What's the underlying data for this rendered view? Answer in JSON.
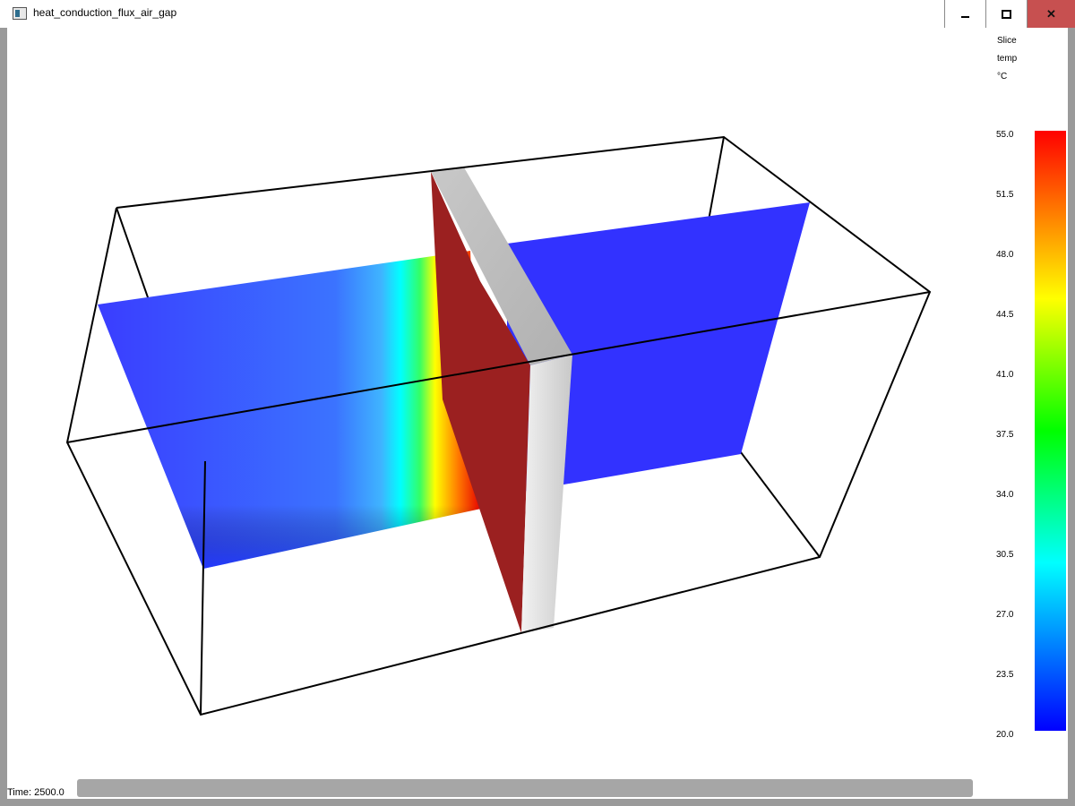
{
  "window": {
    "title": "heat_conduction_flux_air_gap",
    "icon": "app-window-icon",
    "controls": [
      "minimize-icon",
      "maximize-icon",
      "close-icon"
    ]
  },
  "legend": {
    "label_line1": "Slice",
    "label_line2": "temp",
    "unit": "°C",
    "min": 20.0,
    "max": 55.0,
    "ticks": [
      "55.0",
      "51.5",
      "48.0",
      "44.5",
      "41.0",
      "37.5",
      "34.0",
      "30.5",
      "27.0",
      "23.5",
      "20.0"
    ],
    "colors": {
      "low": "#0000ff",
      "mid_low": "#00ffff",
      "mid": "#00ff00",
      "mid_high": "#ffff00",
      "high": "#ff0000"
    }
  },
  "status": {
    "time_text": "Time: 2500.0"
  },
  "scene": {
    "slice_base_color": "#3333ff",
    "slice_hot_color": "#ff0000",
    "plate_color": "#9b2020",
    "wall_color": "#d9d9d9"
  }
}
